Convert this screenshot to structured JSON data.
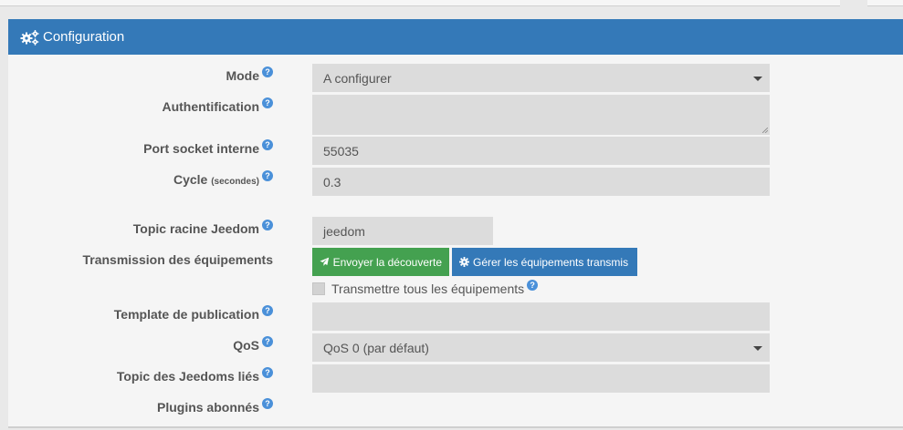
{
  "panel": {
    "title": "Configuration",
    "header_icon": "cogs-icon",
    "accent_color": "#3479b8"
  },
  "form": {
    "mode": {
      "label": "Mode",
      "value": "A configurer"
    },
    "auth": {
      "label": "Authentification",
      "value": ""
    },
    "port": {
      "label": "Port socket interne",
      "value": "55035"
    },
    "cycle": {
      "label": "Cycle",
      "unit": "(secondes)",
      "value": "0.3"
    },
    "topic_root": {
      "label": "Topic racine Jeedom",
      "value": "jeedom"
    },
    "transmission": {
      "label": "Transmission des équipements",
      "send_button": "Envoyer la découverte",
      "manage_button": "Gérer les équipements transmis",
      "checkbox_label": "Transmettre tous les équipements",
      "checkbox_checked": false
    },
    "template": {
      "label": "Template de publication",
      "value": ""
    },
    "qos": {
      "label": "QoS",
      "value": "QoS 0 (par défaut)"
    },
    "linked_topics": {
      "label": "Topic des Jeedoms liés",
      "value": ""
    },
    "plugins": {
      "label": "Plugins abonnés"
    }
  },
  "help_icon_glyph": "?"
}
